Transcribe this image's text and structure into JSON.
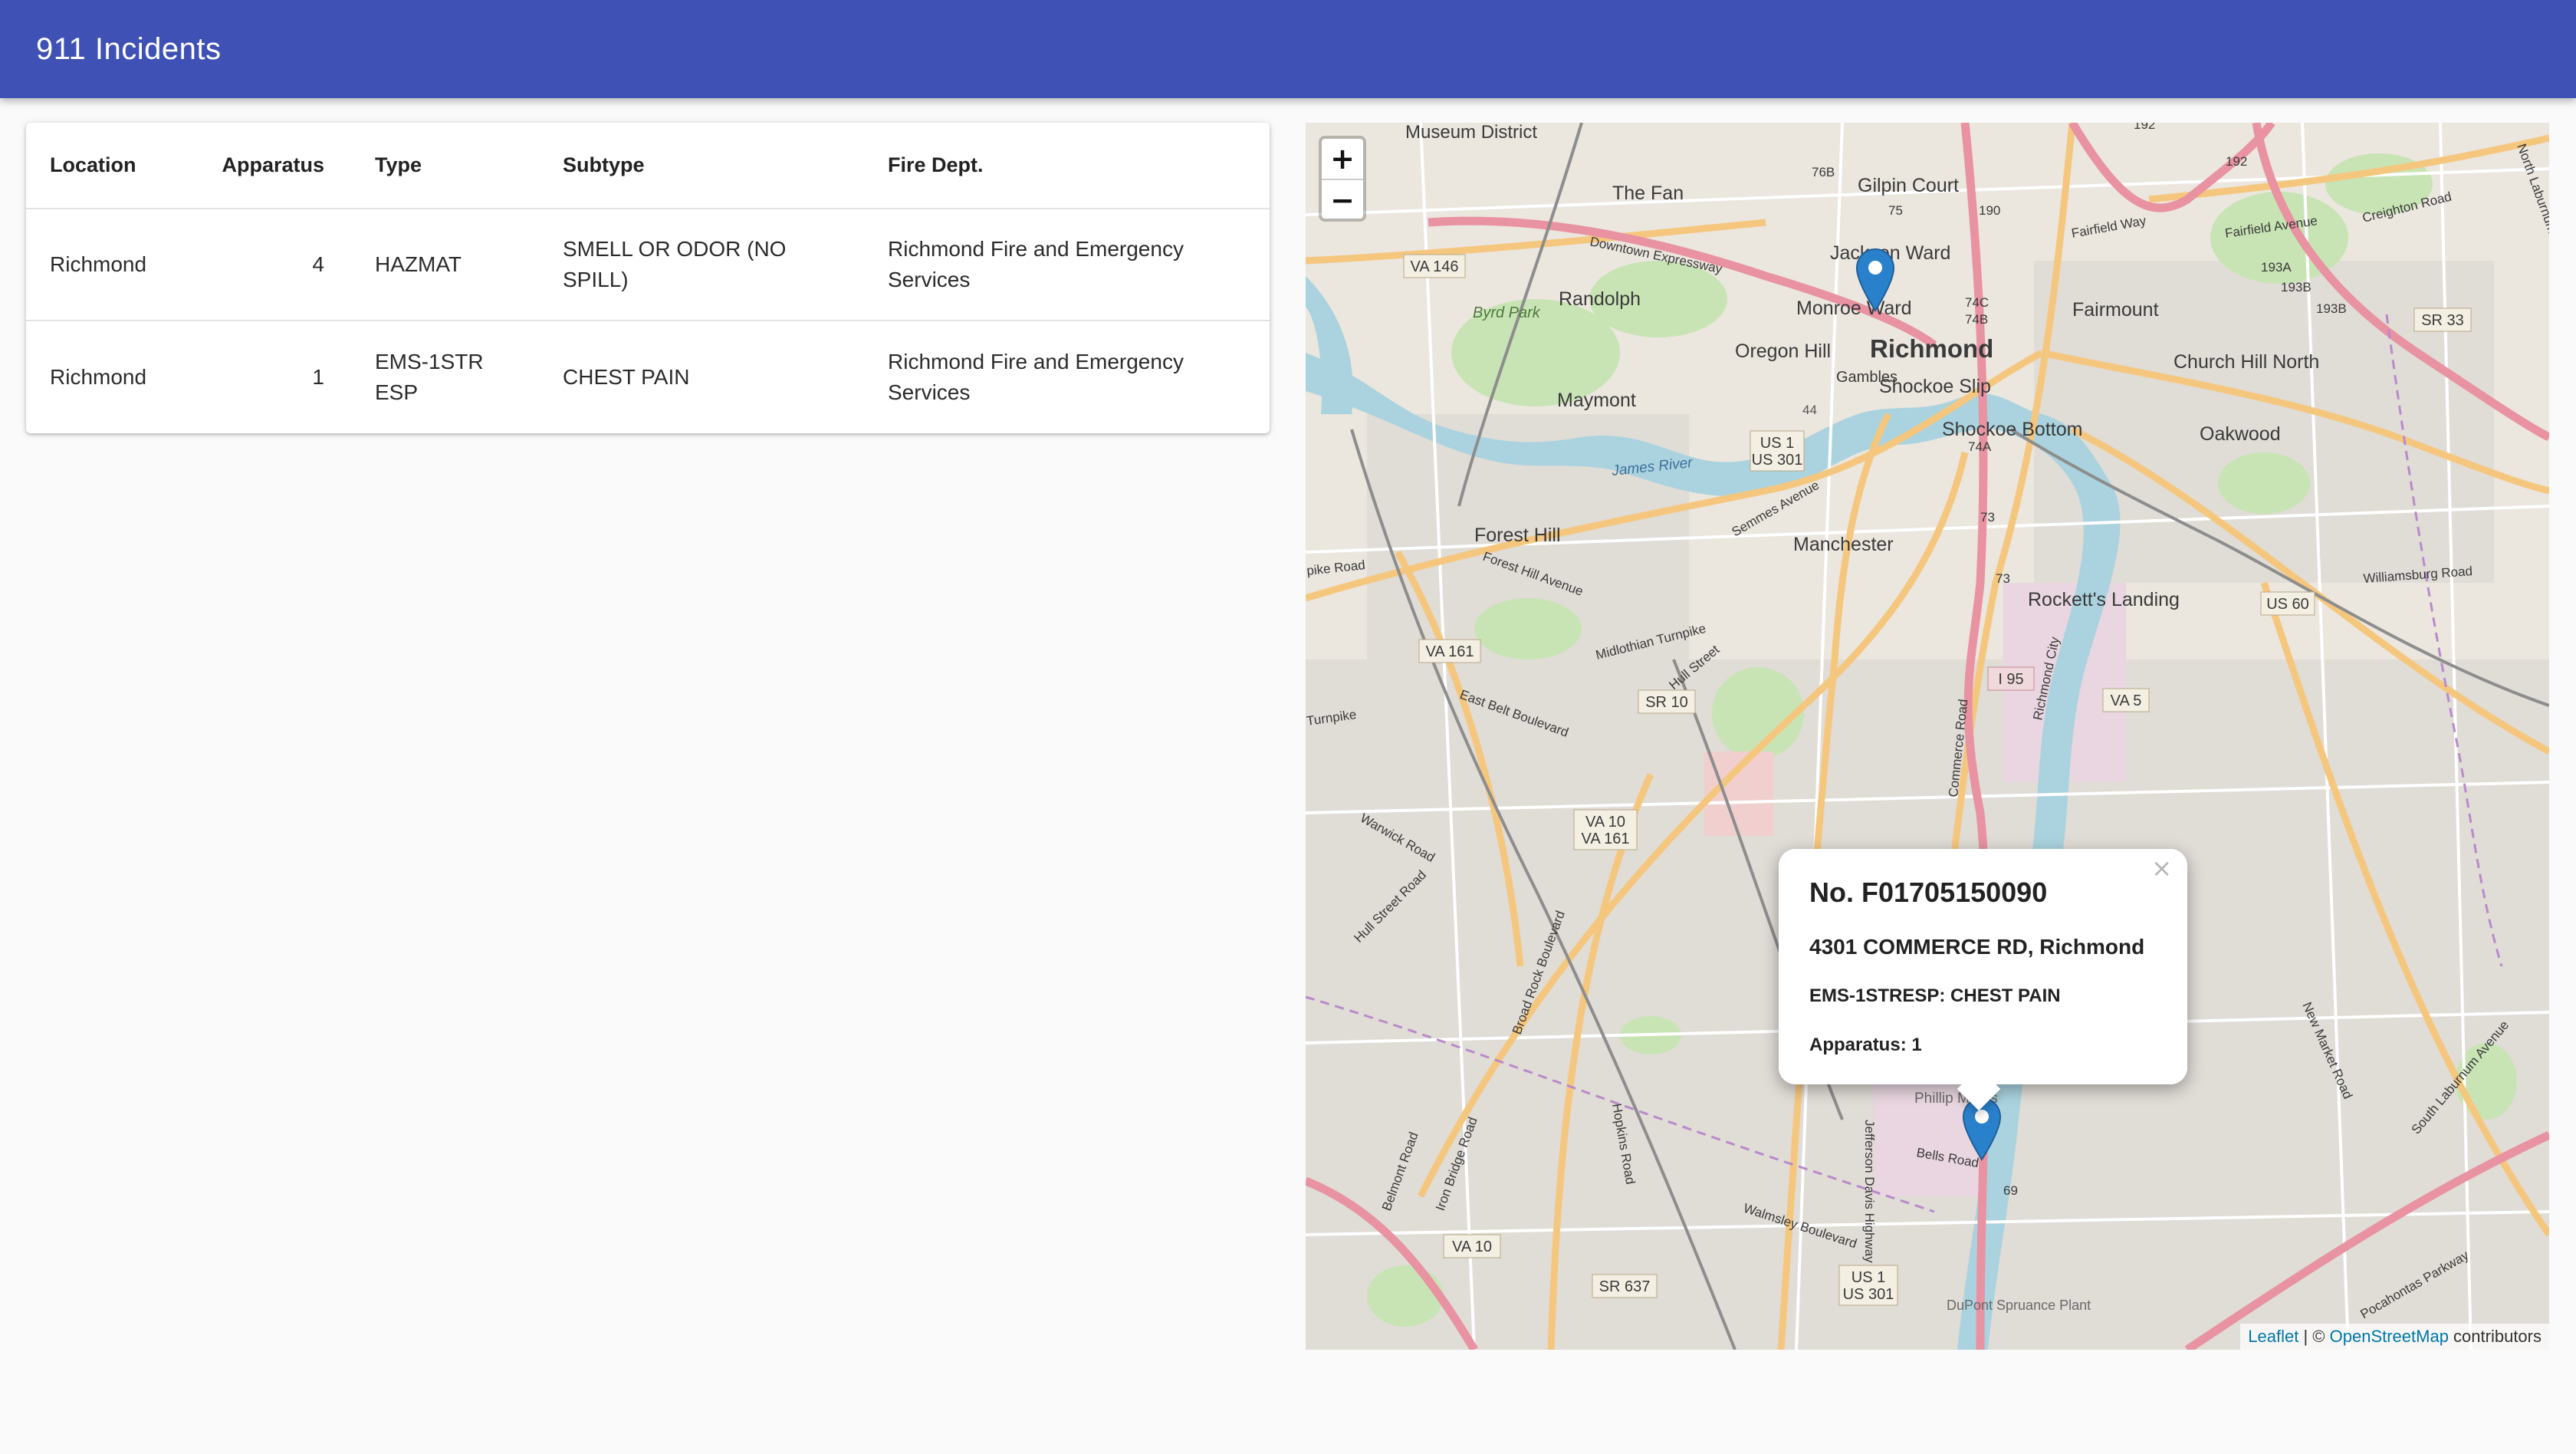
{
  "app": {
    "title": "911 Incidents"
  },
  "table": {
    "headers": [
      "Location",
      "Apparatus",
      "Type",
      "Subtype",
      "Fire Dept."
    ],
    "rows": [
      {
        "location": "Richmond",
        "apparatus": "4",
        "type": "HAZMAT",
        "subtype": "SMELL OR ODOR (NO SPILL)",
        "dept": "Richmond Fire and Emergency Services"
      },
      {
        "location": "Richmond",
        "apparatus": "1",
        "type": "EMS-1STRESP",
        "subtype": "CHEST PAIN",
        "dept": "Richmond Fire and Emergency Services"
      }
    ]
  },
  "map": {
    "zoom_in_label": "+",
    "zoom_out_label": "−",
    "popup": {
      "title": "No. F01705150090",
      "address": "4301 COMMERCE RD, Richmond",
      "type_line": "EMS-1STRESP: CHEST PAIN",
      "apparatus_line": "Apparatus: 1",
      "close_label": "×"
    },
    "attribution": {
      "leaflet": "Leaflet",
      "separator": " | © ",
      "osm": "OpenStreetMap",
      "suffix": " contributors"
    },
    "labels": {
      "museum_district": "Museum District",
      "gilpin_court": "Gilpin Court",
      "the_fan": "The Fan",
      "jackson_ward": "Jackson Ward",
      "monroe_ward": "Monroe Ward",
      "richmond": "Richmond",
      "randolph": "Randolph",
      "oregon_hill": "Oregon Hill",
      "byrd_park": "Byrd Park",
      "maymont": "Maymont",
      "fairmount": "Fairmount",
      "church_hill_north": "Church Hill North",
      "oakwood": "Oakwood",
      "shockoe_slip": "Shockoe Slip",
      "shockoe_bottom": "Shockoe Bottom",
      "gambles": "Gambles",
      "forest_hill": "Forest Hill",
      "manchester": "Manchester",
      "rocketts_landing": "Rockett's Landing",
      "james_river": "James River",
      "phillip_morris": "Phillip Morris",
      "dupont": "DuPont Spruance Plant",
      "downtown_expressway": "Downtown Expressway",
      "midlothian_turnpike": "Midlothian Turnpike",
      "hull_street": "Hull Street",
      "forest_hill_avenue": "Forest Hill Avenue",
      "semmes_avenue": "Semmes Avenue",
      "east_belt_boulevard": "East Belt Boulevard",
      "warwick_road": "Warwick Road",
      "hull_street_road": "Hull Street Road",
      "broad_rock_boulevard": "Broad Rock Boulevard",
      "jefferson_davis_highway": "Jefferson Davis Highway",
      "walmsley_boulevard": "Walmsley Boulevard",
      "bells_road": "Bells Road",
      "commerce_road": "Commerce Road",
      "richmond_city": "Richmond City",
      "new_market_road": "New Market Road",
      "south_laburnum_avenue": "South Laburnum Avenue",
      "williamsburg_road": "Williamsburg Road",
      "fairfield_way": "Fairfield Way",
      "fairfield_avenue": "Fairfield Avenue",
      "creighton_road": "Creighton Road",
      "north_laburnum_avenue": "North Laburnum Avenue",
      "pocahontas_parkway": "Pocahontas Parkway",
      "turnpike": "Turnpike",
      "pike_road": "pike Road",
      "rhaney_road": "Road",
      "iron_bridge_road": "Iron Bridge Road",
      "belmont_road": "Belmont Road",
      "hopkins_road": "Hopkins Road"
    },
    "shields": {
      "va146": "VA 146",
      "us1_301_a": [
        "US 1",
        "US 301"
      ],
      "va161_a": "VA 161",
      "sr10": "SR 10",
      "va10_161": [
        "VA 10",
        "VA 161"
      ],
      "i95": "I 95",
      "va5": "VA 5",
      "us60": "US 60",
      "sr33": "SR 33",
      "va10_b": "VA 10",
      "sr637": "SR 637",
      "us1_301_b": [
        "US 1",
        "US 301"
      ]
    },
    "route_numbers": [
      "76B",
      "75",
      "190",
      "192",
      "192",
      "74B",
      "74C",
      "74A",
      "73",
      "73",
      "69",
      "193A",
      "193B",
      "193B",
      "44"
    ]
  },
  "colors": {
    "appbar": "#3f51b5",
    "marker": "#2a81cb",
    "link": "#0078a8"
  }
}
